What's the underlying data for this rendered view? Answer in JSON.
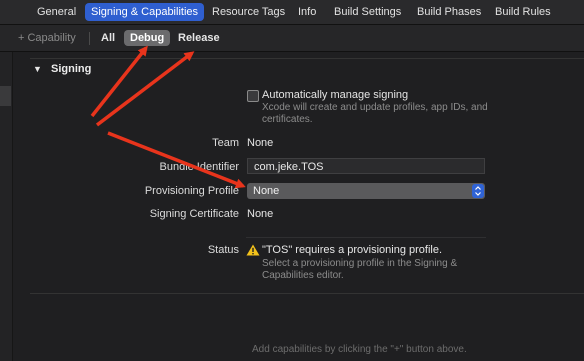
{
  "tabs": [
    "General",
    "Signing & Capabilities",
    "Resource Tags",
    "Info",
    "Build Settings",
    "Build Phases",
    "Build Rules"
  ],
  "toolbar": {
    "capability_label": "+ Capability",
    "all_label": "All",
    "debug_label": "Debug",
    "release_label": "Release"
  },
  "signing": {
    "section_title": "Signing",
    "auto_manage_label": "Automatically manage signing",
    "auto_manage_desc": "Xcode will create and update profiles, app IDs, and certificates.",
    "team_label": "Team",
    "team_value": "None",
    "bundle_identifier_label": "Bundle Identifier",
    "bundle_identifier_value": "com.jeke.TOS",
    "provisioning_profile_label": "Provisioning Profile",
    "provisioning_profile_value": "None",
    "signing_certificate_label": "Signing Certificate",
    "signing_certificate_value": "None",
    "status_label": "Status",
    "status_title": "\"TOS\" requires a provisioning profile.",
    "status_detail": "Select a provisioning profile in the Signing & Capabilities editor."
  },
  "footer_hint": "Add capabilities by clicking the \"+\" button above.",
  "colors": {
    "accent": "#2f5fd0",
    "annotation_arrow": "#e8341c",
    "warning": "#f3c21b"
  },
  "icons": {
    "disclosure": "triangle-down",
    "warning": "warning-triangle",
    "popup_stepper": "chevron-up-down"
  }
}
